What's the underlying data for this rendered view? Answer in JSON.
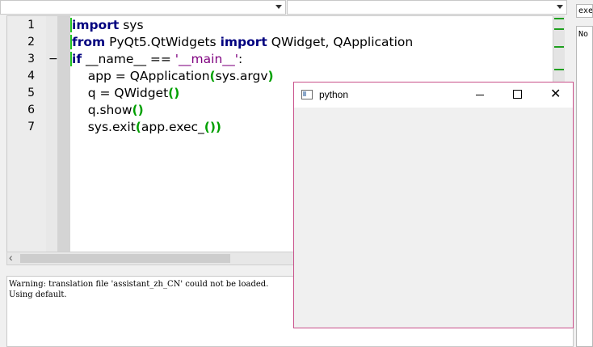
{
  "editor": {
    "line_numbers": [
      "1",
      "2",
      "3",
      "4",
      "5",
      "6",
      "7"
    ],
    "fold_marker": "−",
    "lines": [
      [
        {
          "t": "import",
          "c": "kw"
        },
        {
          "t": " sys",
          "c": ""
        }
      ],
      [
        {
          "t": "from",
          "c": "kw"
        },
        {
          "t": " PyQt5.QtWidgets ",
          "c": ""
        },
        {
          "t": "import",
          "c": "kw"
        },
        {
          "t": " QWidget, QApplication",
          "c": ""
        }
      ],
      [
        {
          "t": "if",
          "c": "kw"
        },
        {
          "t": " __name__ == ",
          "c": ""
        },
        {
          "t": "'__main__'",
          "c": "str"
        },
        {
          "t": ":",
          "c": ""
        }
      ],
      [
        {
          "t": "    app = QApplication",
          "c": ""
        },
        {
          "t": "(",
          "c": "brk"
        },
        {
          "t": "sys.argv",
          "c": ""
        },
        {
          "t": ")",
          "c": "brk"
        }
      ],
      [
        {
          "t": "    q = QWidget",
          "c": ""
        },
        {
          "t": "()",
          "c": "brk"
        }
      ],
      [
        {
          "t": "    q.show",
          "c": ""
        },
        {
          "t": "()",
          "c": "brk"
        }
      ],
      [
        {
          "t": "    sys.exit",
          "c": ""
        },
        {
          "t": "(",
          "c": "brk"
        },
        {
          "t": "app.exec_",
          "c": ""
        },
        {
          "t": "()",
          "c": "brk"
        },
        {
          "t": ")",
          "c": "brk"
        }
      ]
    ]
  },
  "console": {
    "lines": [
      "Warning: translation file 'assistant_zh_CN' could not be loaded.",
      "Using default."
    ]
  },
  "right_pane": {
    "field_text": "exec",
    "list_text": "No"
  },
  "qt_window": {
    "title": "python",
    "minimize_label": "",
    "maximize_label": "",
    "close_label": "✕"
  },
  "colors": {
    "keyword": "#00007f",
    "string": "#7f007f",
    "brace_match": "#00a000",
    "window_border": "#c9508a"
  }
}
